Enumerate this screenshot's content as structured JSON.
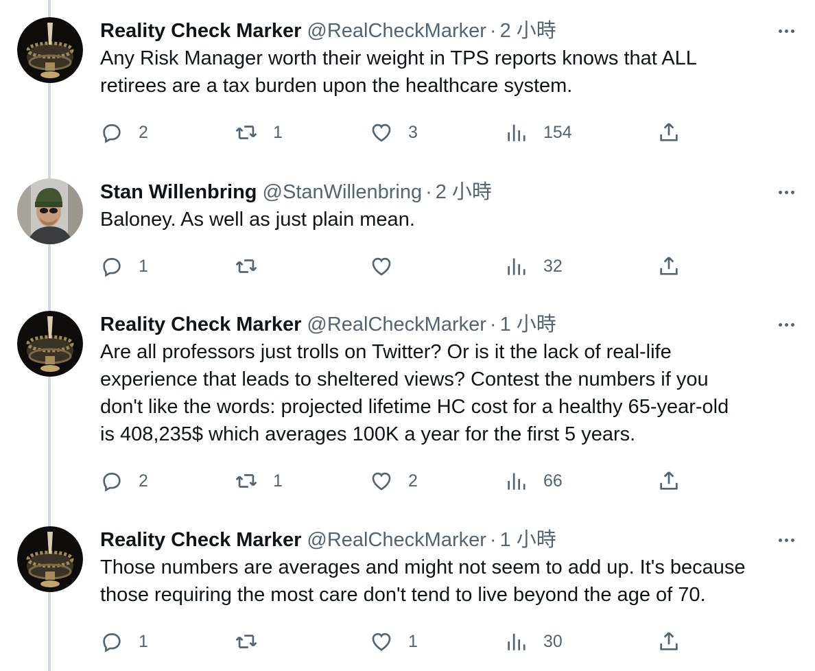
{
  "thread": {
    "tweets": [
      {
        "name": "Reality Check Marker",
        "handle": "@RealCheckMarker",
        "separator": "·",
        "time": "2 小時",
        "text": "Any Risk Manager worth their weight in TPS reports knows that ALL retirees are a tax burden upon the healthcare system.",
        "replies": "2",
        "retweets": "1",
        "likes": "3",
        "views": "154",
        "avatar": "goblet-avatar"
      },
      {
        "name": "Stan Willenbring",
        "handle": "@StanWillenbring",
        "separator": "·",
        "time": "2 小時",
        "text": "Baloney. As well as just plain mean.",
        "replies": "1",
        "retweets": "",
        "likes": "",
        "views": "32",
        "avatar": "man-in-beanie-avatar"
      },
      {
        "name": "Reality Check Marker",
        "handle": "@RealCheckMarker",
        "separator": "·",
        "time": "1 小時",
        "text": "Are all professors just trolls on Twitter? Or is it the lack of real-life\nexperience that leads to sheltered views? Contest the numbers if you\ndon't like the words:  projected lifetime HC cost for a healthy 65-year-old\nis 408,235$ which averages 100K a year for the first 5 years.",
        "replies": "2",
        "retweets": "1",
        "likes": "2",
        "views": "66",
        "avatar": "goblet-avatar"
      },
      {
        "name": "Reality Check Marker",
        "handle": "@RealCheckMarker",
        "separator": "·",
        "time": "1 小時",
        "text": "Those numbers are averages and might not seem to add up. It's because\nthose requiring the most care don't tend to live beyond the age of 70.",
        "replies": "1",
        "retweets": "",
        "likes": "1",
        "views": "30",
        "avatar": "goblet-avatar"
      }
    ]
  },
  "colors": {
    "text_primary": "#0f1419",
    "text_secondary": "#536471",
    "thread_line": "#cfd9de"
  }
}
